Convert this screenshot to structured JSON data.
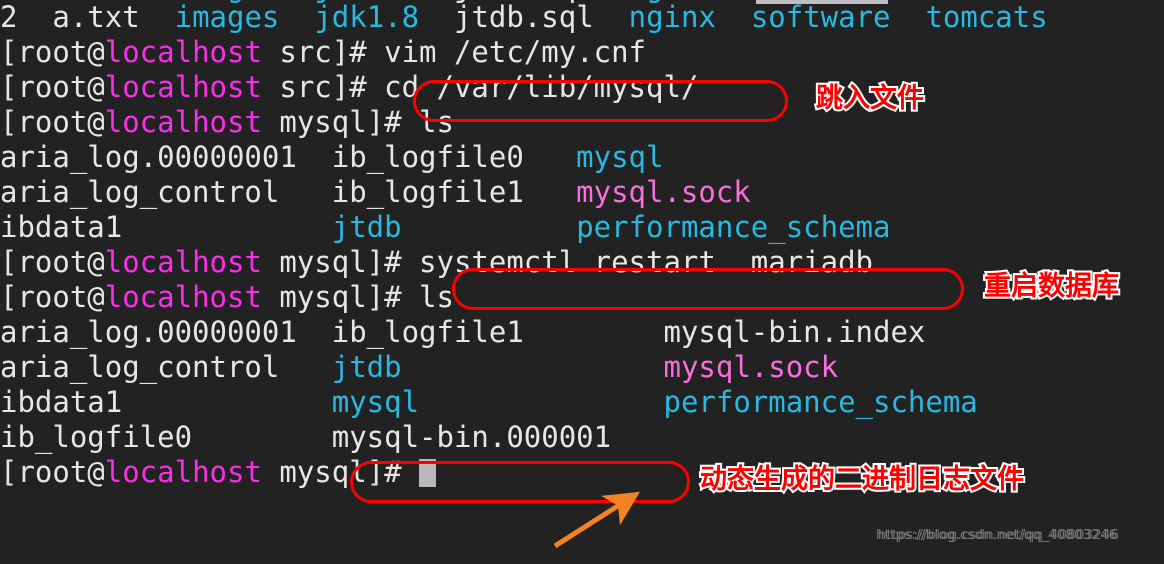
{
  "terminal": {
    "background_color": "#222222",
    "colors": {
      "default_text": "#e8e6e3",
      "directory_cyan": "#29b8e0",
      "host_magenta": "#f92ee8",
      "socket_pink": "#f96edc",
      "annotation_red": "#ff0000",
      "arrow_orange": "#f58220",
      "cursor_gray": "#b9b9bd"
    },
    "lines": [
      {
        "id": "line-ls-home",
        "segments": [
          {
            "text": "2  ",
            "color": "default"
          },
          {
            "text": "a.txt",
            "color": "default"
          },
          {
            "text": "  ",
            "color": "default"
          },
          {
            "text": "images",
            "color": "cyan"
          },
          {
            "text": "  ",
            "color": "default"
          },
          {
            "text": "jdk1.8",
            "color": "cyan"
          },
          {
            "text": "  ",
            "color": "default"
          },
          {
            "text": "jtdb.sql",
            "color": "default"
          },
          {
            "text": "  ",
            "color": "default"
          },
          {
            "text": "nginx",
            "color": "cyan"
          },
          {
            "text": "  ",
            "color": "default"
          },
          {
            "text": "software",
            "color": "cyan"
          },
          {
            "text": "  ",
            "color": "default"
          },
          {
            "text": "tomcats",
            "color": "cyan"
          }
        ]
      },
      {
        "id": "line-vim",
        "segments": [
          {
            "text": "[root@",
            "color": "default"
          },
          {
            "text": "localhost",
            "color": "magenta"
          },
          {
            "text": " src]# vim /etc/my.cnf",
            "color": "default"
          }
        ]
      },
      {
        "id": "line-cd",
        "segments": [
          {
            "text": "[root@",
            "color": "default"
          },
          {
            "text": "localhost",
            "color": "magenta"
          },
          {
            "text": " src]# cd /var/lib/mysql/",
            "color": "default"
          }
        ]
      },
      {
        "id": "line-prompt-ls-1",
        "segments": [
          {
            "text": "[root@",
            "color": "default"
          },
          {
            "text": "localhost",
            "color": "magenta"
          },
          {
            "text": " mysql]# ls",
            "color": "default"
          }
        ]
      },
      {
        "id": "line-ls1-row1",
        "segments": [
          {
            "text": "aria_log.00000001  ",
            "color": "default"
          },
          {
            "text": "ib_logfile0   ",
            "color": "default"
          },
          {
            "text": "mysql",
            "color": "cyan"
          }
        ]
      },
      {
        "id": "line-ls1-row2",
        "segments": [
          {
            "text": "aria_log_control   ",
            "color": "default"
          },
          {
            "text": "ib_logfile1   ",
            "color": "default"
          },
          {
            "text": "mysql.sock",
            "color": "pink"
          }
        ]
      },
      {
        "id": "line-ls1-row3",
        "segments": [
          {
            "text": "ibdata1            ",
            "color": "default"
          },
          {
            "text": "jtdb",
            "color": "cyan"
          },
          {
            "text": "          ",
            "color": "default"
          },
          {
            "text": "performance_schema",
            "color": "cyan"
          }
        ]
      },
      {
        "id": "line-systemctl",
        "segments": [
          {
            "text": "[root@",
            "color": "default"
          },
          {
            "text": "localhost",
            "color": "magenta"
          },
          {
            "text": " mysql]# systemctl restart  mariadb",
            "color": "default"
          }
        ]
      },
      {
        "id": "line-prompt-ls-2",
        "segments": [
          {
            "text": "[root@",
            "color": "default"
          },
          {
            "text": "localhost",
            "color": "magenta"
          },
          {
            "text": " mysql]# ls",
            "color": "default"
          }
        ]
      },
      {
        "id": "line-ls2-row1",
        "segments": [
          {
            "text": "aria_log.00000001  ",
            "color": "default"
          },
          {
            "text": "ib_logfile1        ",
            "color": "default"
          },
          {
            "text": "mysql-bin.index",
            "color": "default"
          }
        ]
      },
      {
        "id": "line-ls2-row2",
        "segments": [
          {
            "text": "aria_log_control   ",
            "color": "default"
          },
          {
            "text": "jtdb",
            "color": "cyan"
          },
          {
            "text": "               ",
            "color": "default"
          },
          {
            "text": "mysql.sock",
            "color": "pink"
          }
        ]
      },
      {
        "id": "line-ls2-row3",
        "segments": [
          {
            "text": "ibdata1            ",
            "color": "default"
          },
          {
            "text": "mysql",
            "color": "cyan"
          },
          {
            "text": "              ",
            "color": "default"
          },
          {
            "text": "performance_schema",
            "color": "cyan"
          }
        ]
      },
      {
        "id": "line-ls2-row4",
        "segments": [
          {
            "text": "ib_logfile0        ",
            "color": "default"
          },
          {
            "text": "mysql-bin.000001",
            "color": "default"
          }
        ]
      },
      {
        "id": "line-final-prompt",
        "segments": [
          {
            "text": "[root@",
            "color": "default"
          },
          {
            "text": "localhost",
            "color": "magenta"
          },
          {
            "text": " mysql]# ",
            "color": "default"
          },
          {
            "text": "",
            "color": "cursor"
          }
        ]
      }
    ]
  },
  "annotations": {
    "boxes": [
      {
        "id": "box-cd-command",
        "label_target": "cd /var/lib/mysql/"
      },
      {
        "id": "box-systemctl-command",
        "label_target": "systemctl restart  mariadb"
      },
      {
        "id": "box-mysql-bin-file",
        "label_target": "mysql-bin.000001"
      }
    ],
    "labels": [
      {
        "id": "label-cd",
        "text": "跳入文件"
      },
      {
        "id": "label-systemctl",
        "text": "重启数据库"
      },
      {
        "id": "label-binlog",
        "text": "动态生成的二进制日志文件"
      }
    ],
    "arrow": {
      "id": "arrow-to-binlog",
      "color": "#f58220"
    }
  },
  "watermark": {
    "text": "https://blog.csdn.net/qq_40803246"
  }
}
